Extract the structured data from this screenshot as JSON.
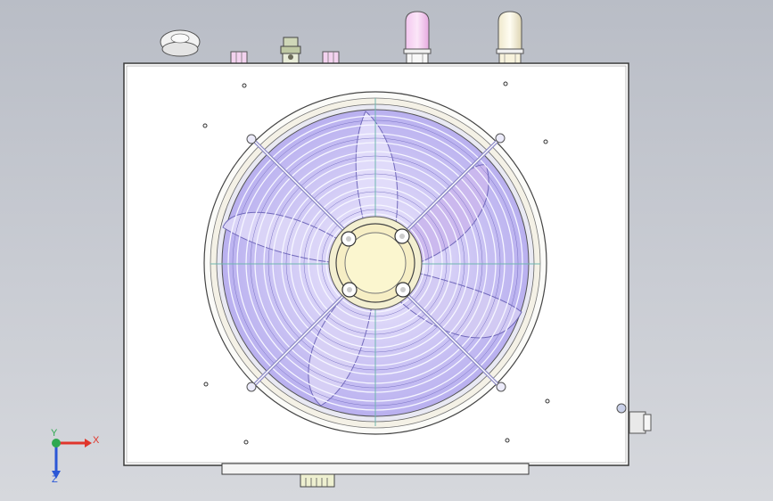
{
  "viewport": {
    "background_top": "#b9bdc6",
    "background_bottom": "#d6d8dd"
  },
  "triad": {
    "x_label": "X",
    "y_label": "Y",
    "z_label": "Z",
    "x_color": "#e0352b",
    "y_color": "#2fa84f",
    "z_color": "#2b57d6"
  },
  "model": {
    "panel_color": "#ffffff",
    "outline_color": "#3a3a3a",
    "fan_blade_color": "#c9c4f0",
    "hub_color": "#f6f0b8",
    "top_fittings": [
      "cap-knob",
      "small-port-left",
      "valve",
      "small-port-right",
      "pink-pipe",
      "cream-pipe"
    ]
  }
}
